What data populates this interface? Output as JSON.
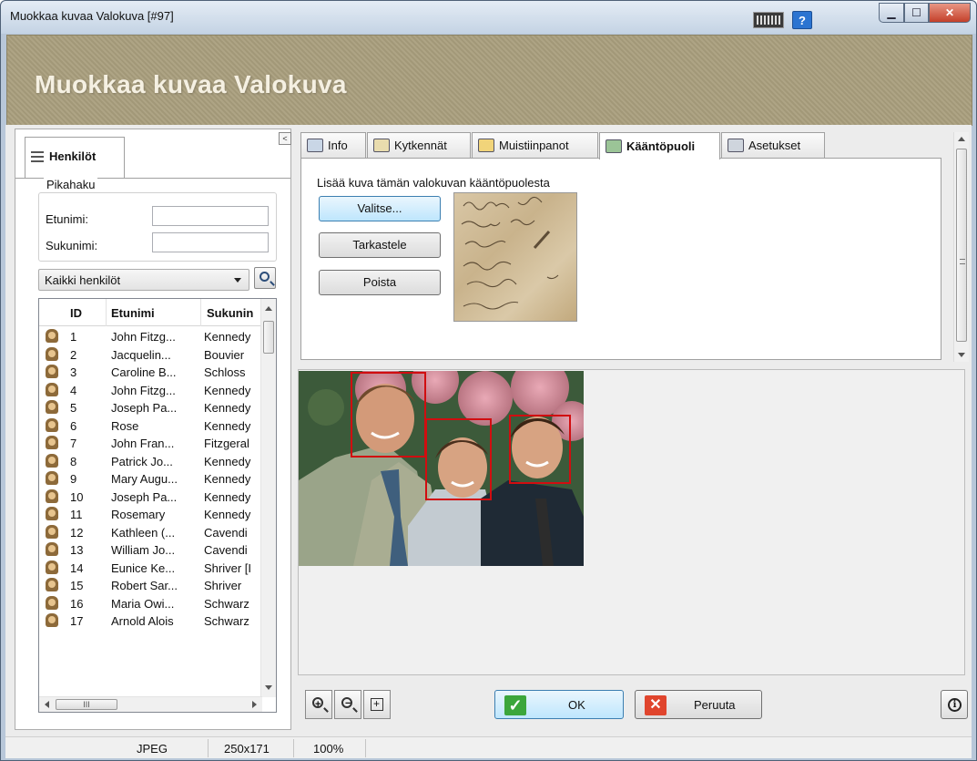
{
  "window": {
    "title": "Muokkaa kuvaa Valokuva [#97]"
  },
  "banner": {
    "heading": "Muokkaa kuvaa Valokuva"
  },
  "left": {
    "tab_label": "Henkilöt",
    "collapse_glyph": "<",
    "quick_search": {
      "legend": "Pikahaku",
      "first_name_label": "Etunimi:",
      "last_name_label": "Sukunimi:",
      "first_name_value": "",
      "last_name_value": ""
    },
    "filter_value": "Kaikki henkilöt",
    "grid": {
      "headers": {
        "id": "ID",
        "first": "Etunimi",
        "last": "Sukunin"
      },
      "rows": [
        {
          "id": "1",
          "first": "John Fitzg...",
          "last": "Kennedy"
        },
        {
          "id": "2",
          "first": "Jacquelin...",
          "last": "Bouvier"
        },
        {
          "id": "3",
          "first": "Caroline B...",
          "last": "Schloss"
        },
        {
          "id": "4",
          "first": "John Fitzg...",
          "last": "Kennedy"
        },
        {
          "id": "5",
          "first": "Joseph Pa...",
          "last": "Kennedy"
        },
        {
          "id": "6",
          "first": "Rose",
          "last": "Kennedy"
        },
        {
          "id": "7",
          "first": "John Fran...",
          "last": "Fitzgeral"
        },
        {
          "id": "8",
          "first": "Patrick Jo...",
          "last": "Kennedy"
        },
        {
          "id": "9",
          "first": "Mary Augu...",
          "last": "Kennedy"
        },
        {
          "id": "10",
          "first": "Joseph Pa...",
          "last": "Kennedy"
        },
        {
          "id": "11",
          "first": "Rosemary",
          "last": "Kennedy"
        },
        {
          "id": "12",
          "first": "Kathleen (...",
          "last": "Cavendi"
        },
        {
          "id": "13",
          "first": "William Jo...",
          "last": "Cavendi"
        },
        {
          "id": "14",
          "first": "Eunice Ke...",
          "last": "Shriver [I"
        },
        {
          "id": "15",
          "first": "Robert Sar...",
          "last": "Shriver"
        },
        {
          "id": "16",
          "first": "Maria Owi...",
          "last": "Schwarz"
        },
        {
          "id": "17",
          "first": "Arnold Alois",
          "last": "Schwarz"
        }
      ],
      "hscroll_grip": "III"
    }
  },
  "tabs": [
    {
      "label": "Info",
      "icon": "info-icon"
    },
    {
      "label": "Kytkennät",
      "icon": "links-icon"
    },
    {
      "label": "Muistiinpanot",
      "icon": "notes-icon"
    },
    {
      "label": "Kääntöpuoli",
      "icon": "reverse-side-icon",
      "active": true
    },
    {
      "label": "Asetukset",
      "icon": "settings-icon"
    }
  ],
  "reverse": {
    "instruction": "Lisää kuva tämän valokuvan kääntöpuolesta",
    "select_label": "Valitse...",
    "view_label": "Tarkastele",
    "delete_label": "Poista"
  },
  "footer": {
    "ok_label": "OK",
    "cancel_label": "Peruuta",
    "ok_color": "#3ba63b",
    "cancel_color": "#e0452d"
  },
  "status": {
    "format": "JPEG",
    "dimensions": "250x171",
    "zoom": "100%"
  }
}
